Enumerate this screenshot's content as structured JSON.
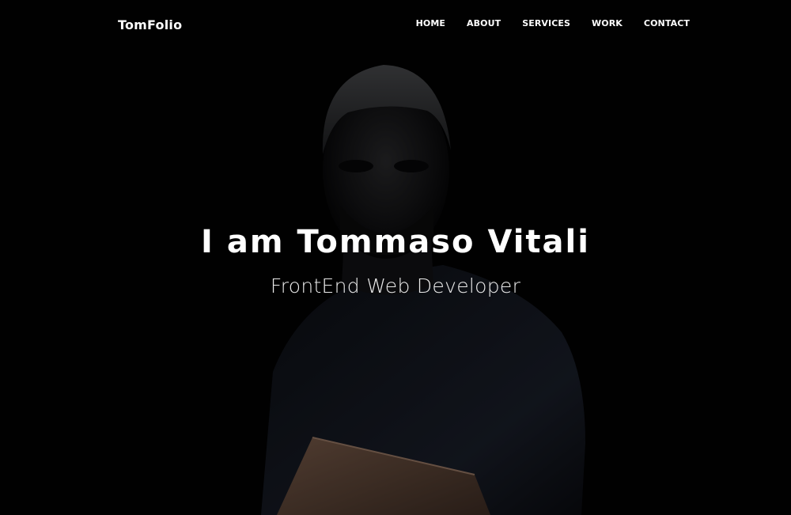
{
  "navbar": {
    "brand": "TomFolio",
    "links": [
      {
        "label": "HOME"
      },
      {
        "label": "ABOUT"
      },
      {
        "label": "SERVICES"
      },
      {
        "label": "WORK"
      },
      {
        "label": "CONTACT"
      }
    ]
  },
  "hero": {
    "title": "I am Tommaso Vitali",
    "subtitle": "FrontEnd Web Developer",
    "background_image": "portrait-photo",
    "overlay_color": "#000000"
  },
  "colors": {
    "background": "#020203",
    "text": "#ffffff"
  }
}
